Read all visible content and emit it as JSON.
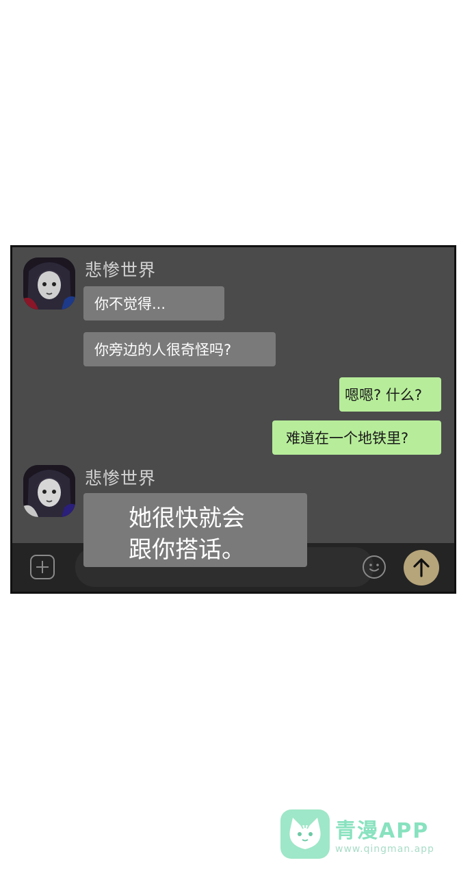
{
  "chat": {
    "messages": [
      {
        "sender": "悲惨世界",
        "text": "你不觉得..."
      },
      {
        "text": "你旁边的人很奇怪吗?"
      },
      {
        "text": "嗯嗯? 什么?",
        "from_me": true
      },
      {
        "text": "难道在一个地铁里?",
        "from_me": true
      },
      {
        "sender": "悲惨世界",
        "text": "她很快就会\n跟你搭话。"
      }
    ]
  },
  "input_bar": {
    "icons": [
      "plus-icon",
      "smiley-icon",
      "arrow-up-icon"
    ]
  },
  "watermark": {
    "title": "青漫APP",
    "url": "www.qingman.app"
  },
  "colors": {
    "chat_bg": "#4b4b4b",
    "received_bubble": "#7a7a7a",
    "sent_bubble": "#b7ed9a",
    "send_button": "#b6a47a",
    "watermark": "#88e2bf"
  }
}
